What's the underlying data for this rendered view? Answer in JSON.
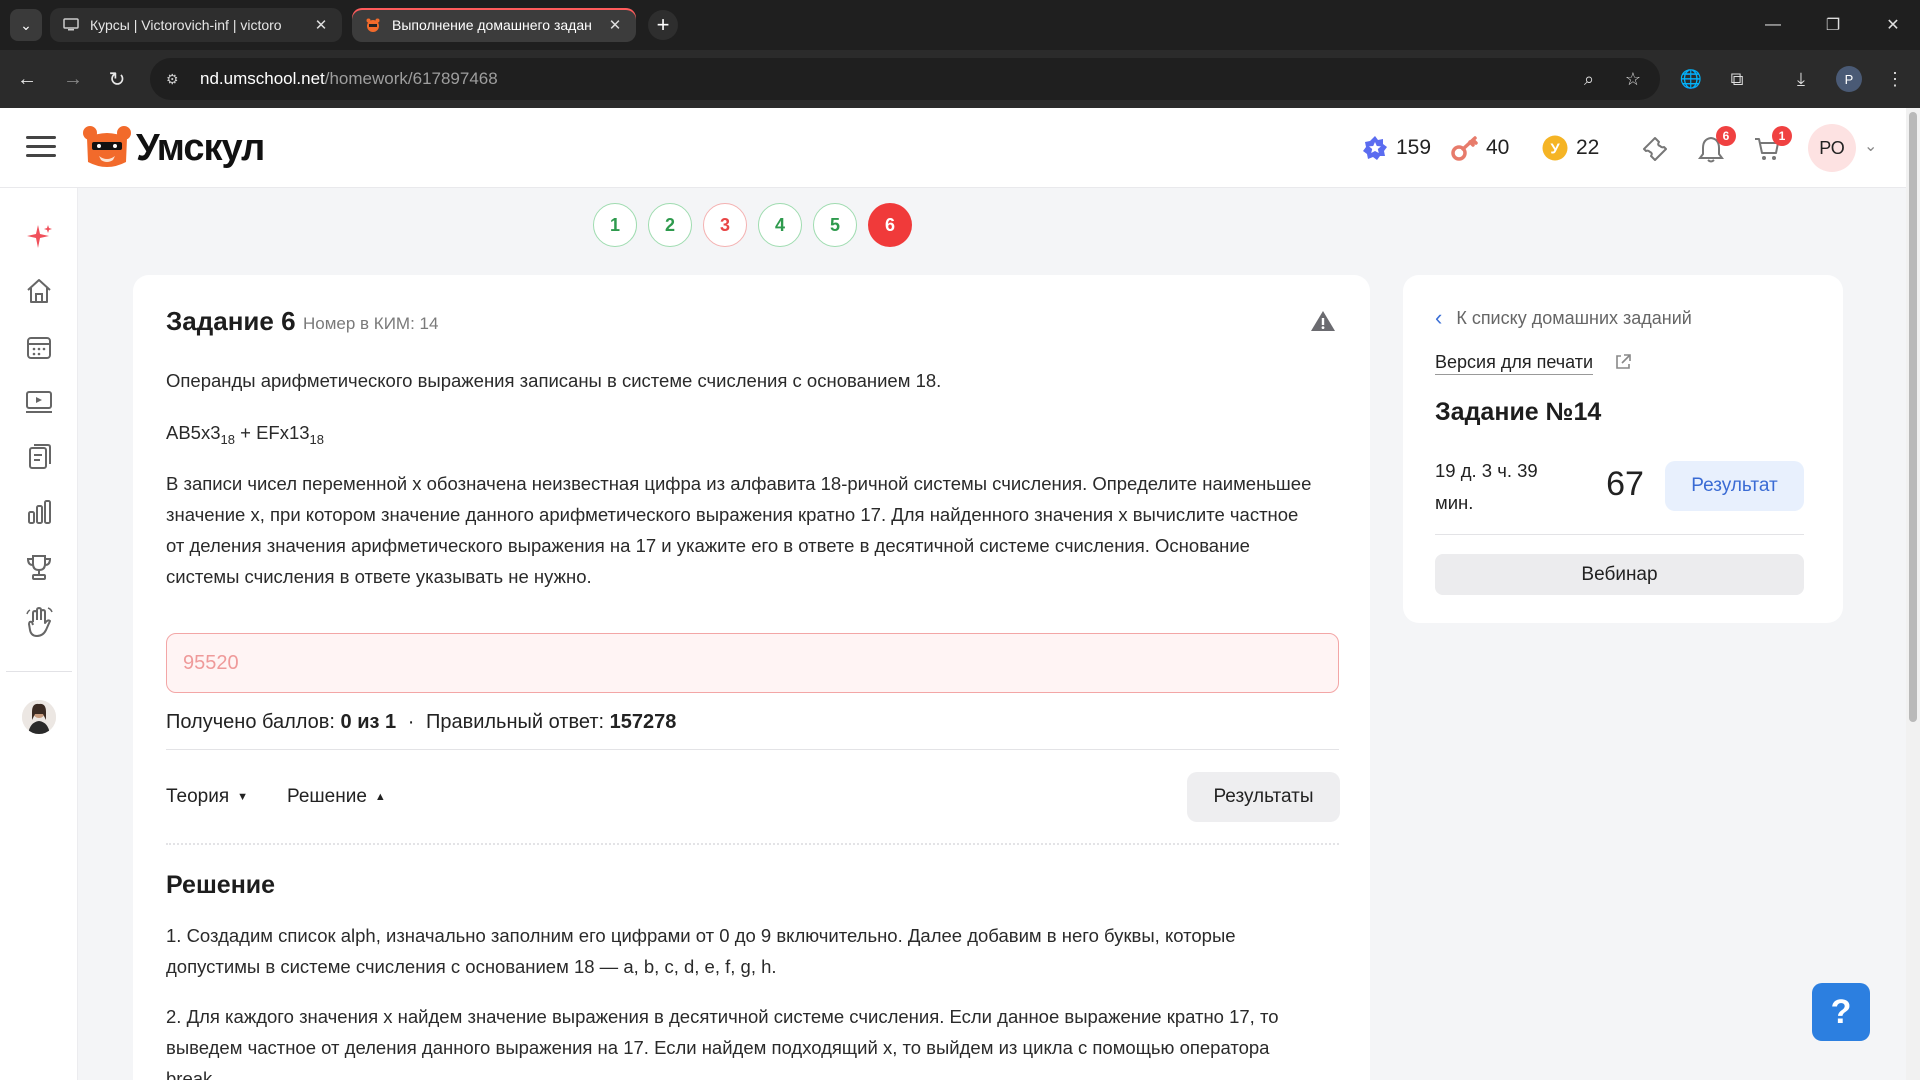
{
  "browser": {
    "tabs": [
      {
        "title": "Курсы | Victorovich-inf | victoro",
        "active": false
      },
      {
        "title": "Выполнение домашнего задан",
        "active": true
      }
    ],
    "new_tab": "+",
    "url_host": "nd.umschool.net",
    "url_path": "/homework/617897468",
    "profile_initial": "P"
  },
  "header": {
    "logo_text": "Умскул",
    "stats": {
      "stars": "159",
      "keys": "40",
      "coins": "22",
      "coin_letter": "У"
    },
    "notifications_count": "6",
    "cart_count": "1",
    "avatar_initials": "РО"
  },
  "question_nav": [
    {
      "label": "1",
      "status": "ok"
    },
    {
      "label": "2",
      "status": "ok"
    },
    {
      "label": "3",
      "status": "bad"
    },
    {
      "label": "4",
      "status": "ok"
    },
    {
      "label": "5",
      "status": "ok"
    },
    {
      "label": "6",
      "status": "current"
    }
  ],
  "task": {
    "title": "Задание 6",
    "kim": "Номер в КИМ: 14",
    "intro": "Операнды арифметического выражения записаны в системе счисления с основанием 18.",
    "expr_part1": "AB5x3",
    "expr_sub1": "18",
    "expr_mid": " + EFx13",
    "expr_sub2": "18",
    "body": "В записи чисел переменной x обозначена неизвестная цифра из алфавита 18-ричной системы счисления. Определите наименьшее значение x, при котором значение данного арифметического выражения кратно 17. Для найденного значения x вычислите частное от деления значения арифметического выражения на 17 и укажите его в ответе в десятичной системе счисления. Основание системы счисления в ответе указывать не нужно.",
    "user_answer": "95520",
    "score_label": "Получено баллов: ",
    "score_value": "0 из 1",
    "dot": "·",
    "correct_label": "Правильный ответ: ",
    "correct_value": "157278",
    "theory_label": "Теория",
    "solution_label": "Решение",
    "results_button": "Результаты",
    "solution_title": "Решение",
    "solution_p1": "1. Создадим список alph, изначально заполним его цифрами от 0 до 9 включительно. Далее добавим в него буквы, которые допустимы в системе счисления с основанием 18 — a, b, c, d, e, f, g, h.",
    "solution_p2": "2. Для каждого значения x найдем значение выражения в десятичной системе счисления. Если данное выражение кратно 17, то выведем частное от деления данного выражения на 17. Если найдем подходящий x, то выйдем из цикла с помощью оператора break."
  },
  "right_panel": {
    "back_link": "К списку домашних заданий",
    "print_link": "Версия для печати",
    "title": "Задание №14",
    "time_left": "19 д. 3 ч. 39 мин.",
    "score": "67",
    "result_button": "Результат",
    "webinar_button": "Вебинар"
  },
  "help_button": "?",
  "colors": {
    "accent_red": "#f03a3a",
    "ok_green": "#2e9a4d",
    "link_blue": "#3a6bd4",
    "help_blue": "#2c7fe0"
  }
}
